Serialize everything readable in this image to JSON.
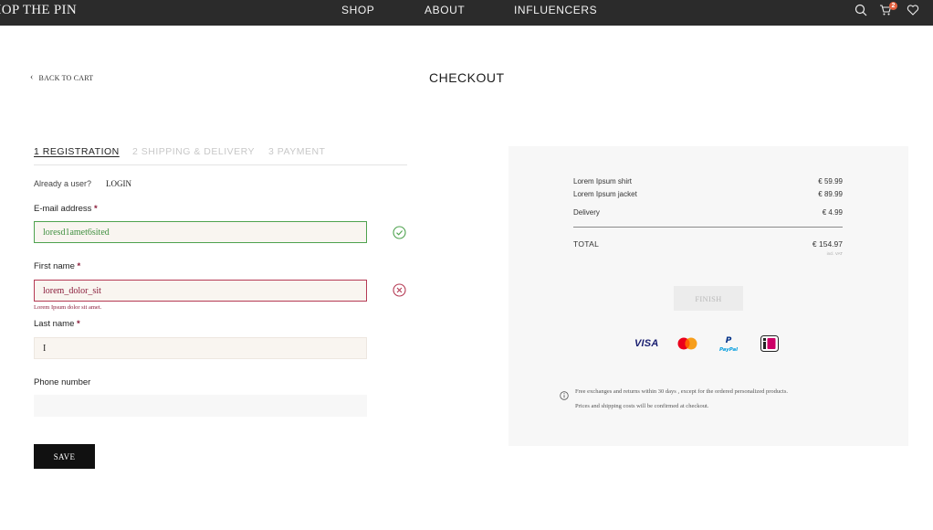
{
  "nav": {
    "brand": "SHOP THE PIN",
    "links": [
      "SHOP",
      "ABOUT",
      "INFLUENCERS"
    ],
    "cart_count": "2",
    "icons": [
      "search-icon",
      "cart-icon",
      "heart-icon"
    ]
  },
  "page": {
    "back_label": "BACK TO CART",
    "title": "CHECKOUT"
  },
  "steps": [
    "1  REGISTRATION",
    "2  SHIPPING & DELIVERY",
    "3  PAYMENT"
  ],
  "form": {
    "already_user": "Already a user?",
    "login_label": "LOGIN",
    "email_label": "E-mail address",
    "email_value": "loresd1amet6sited",
    "first_name_label": "First name",
    "first_name_value": "lorem_dolor_sit",
    "first_name_error": "Lorem Ipsum dolor sit amet.",
    "last_name_label": "Last name",
    "last_name_value": "I",
    "phone_label": "Phone number",
    "phone_value": "",
    "required_mark": "*",
    "save_label": "SAVE"
  },
  "summary": {
    "items": [
      {
        "label": "Lorem Ipsum shirt",
        "amount": "€ 59.99"
      },
      {
        "label": "Lorem Ipsum jacket",
        "amount": "€ 89.99"
      },
      {
        "label": "Delivery",
        "amount": "€ 4.99"
      }
    ],
    "total_label": "TOTAL",
    "total_amount": "€ 154.97",
    "vat_note": "incl. VAT",
    "finish_label": "FINISH",
    "payment_methods": [
      "VISA",
      "Mastercard",
      "PayPal",
      "iDEAL"
    ],
    "paypal_text": "PayPal",
    "info_line1": "Free exchanges and returns within 30 days , except for the ordered personalized products.",
    "info_line2": "Prices and shipping costs will be confirmed at checkout."
  },
  "colors": {
    "topbar": "#2b2b2b",
    "valid": "#4ea24e",
    "error": "#8a1c3a",
    "badge": "#e35f3d"
  }
}
